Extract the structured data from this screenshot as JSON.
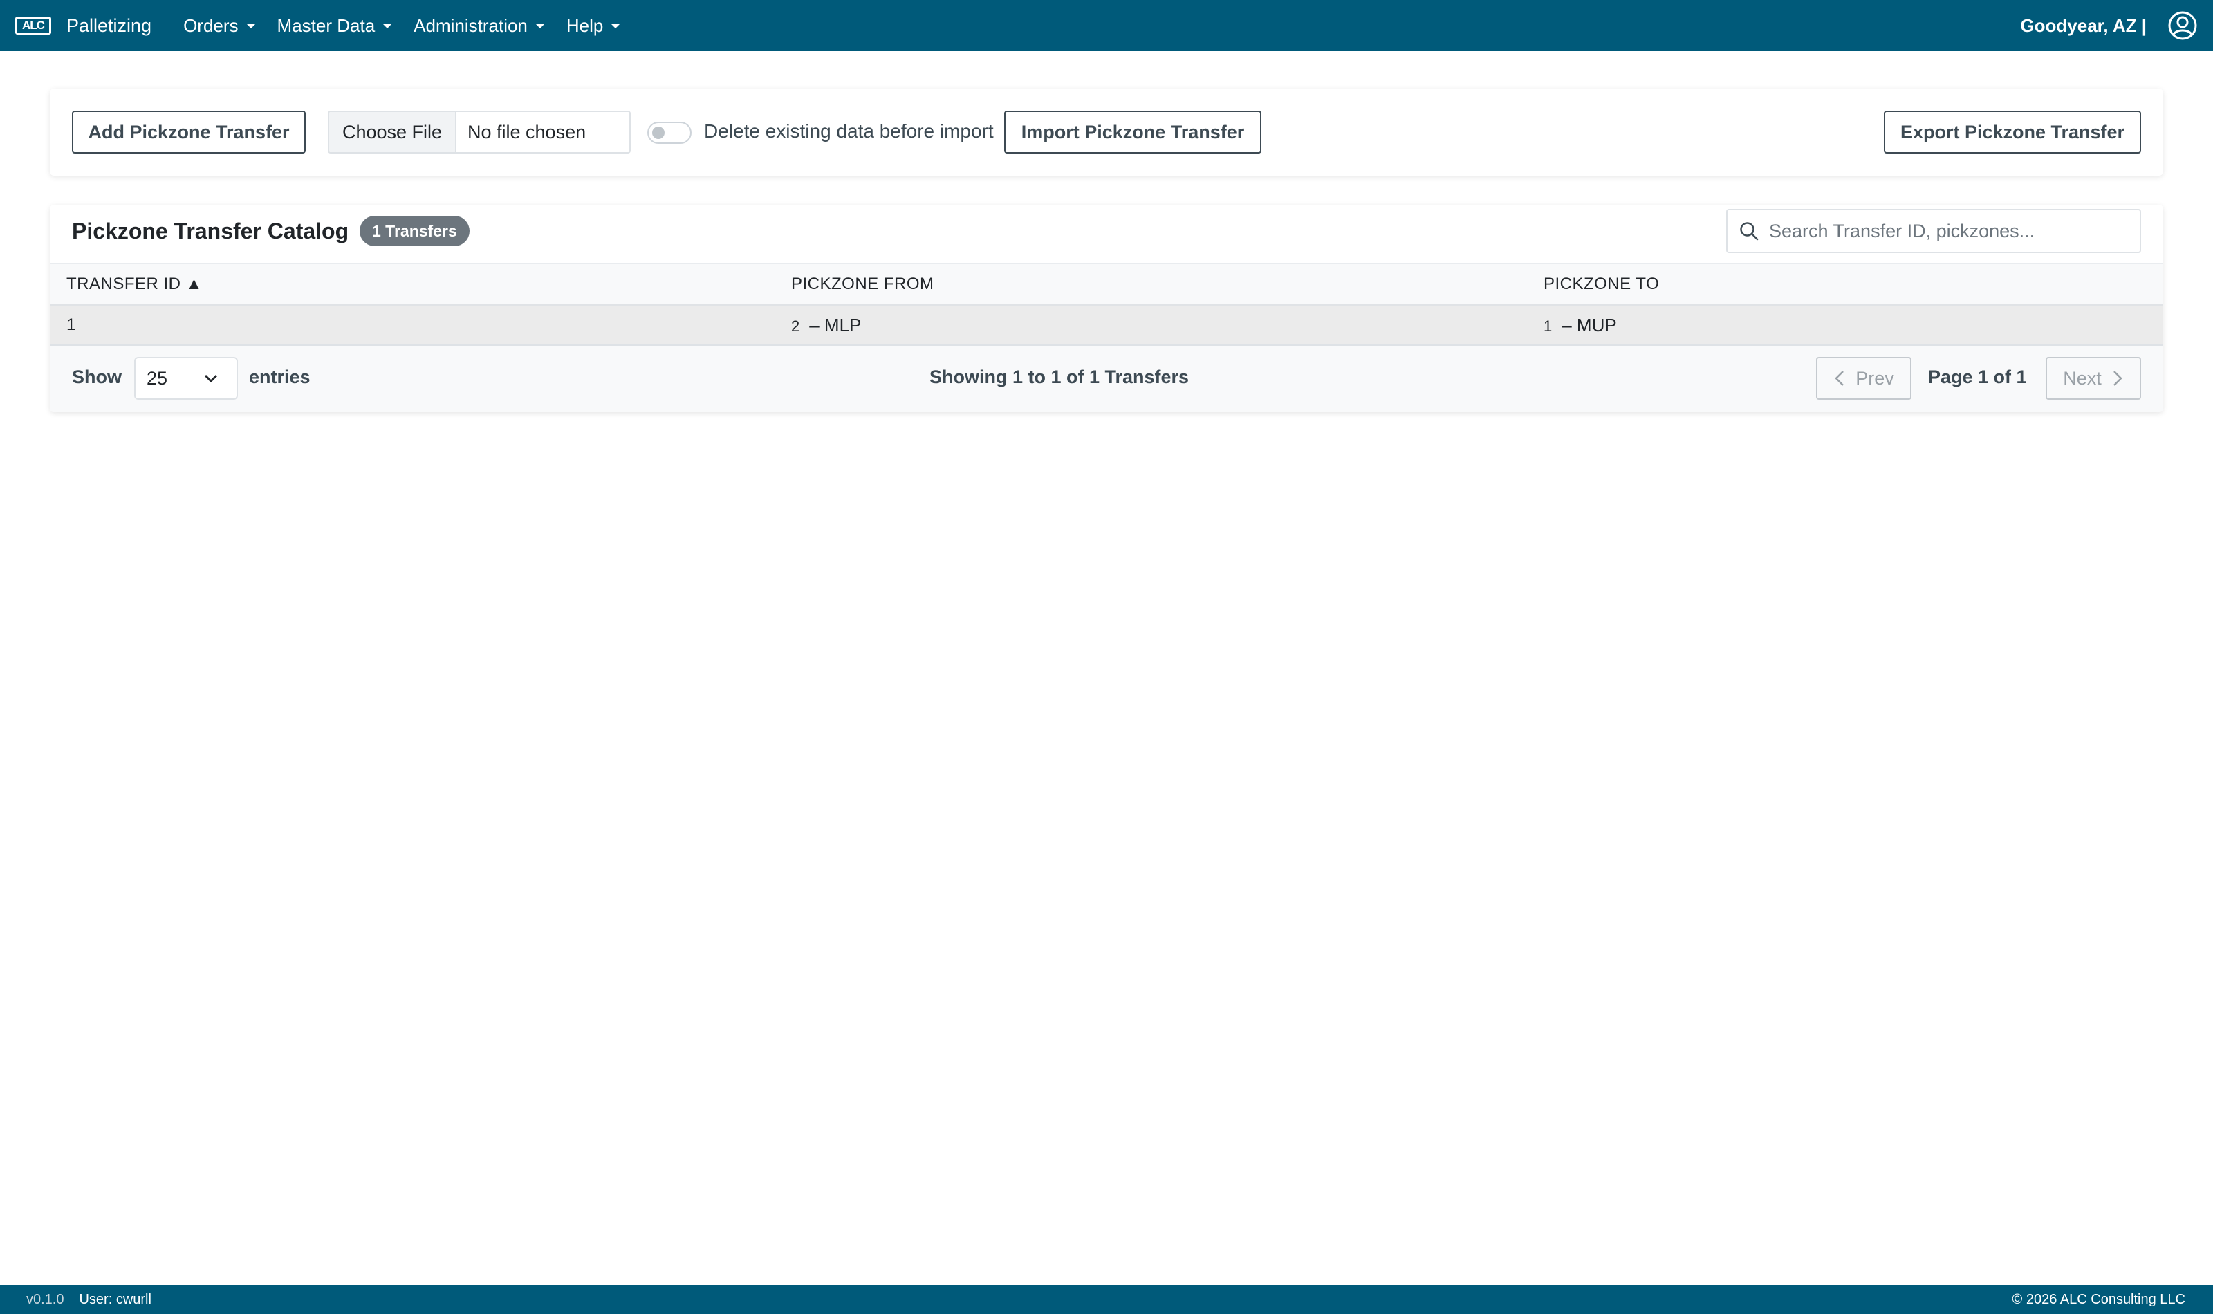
{
  "brand": {
    "logo_text": "ALC",
    "title": "Palletizing"
  },
  "nav": [
    {
      "label": "Orders"
    },
    {
      "label": "Master Data"
    },
    {
      "label": "Administration"
    },
    {
      "label": "Help"
    }
  ],
  "header_right": {
    "location": "Goodyear, AZ |",
    "user_icon": "user-circle-icon"
  },
  "toolbar": {
    "add_label": "Add Pickzone Transfer",
    "file_button": "Choose File",
    "file_status": "No file chosen",
    "delete_toggle_label": "Delete existing data before import",
    "delete_toggle_on": false,
    "import_label": "Import Pickzone Transfer",
    "export_label": "Export Pickzone Transfer"
  },
  "catalog": {
    "title": "Pickzone Transfer Catalog",
    "badge": "1 Transfers",
    "search_placeholder": "Search Transfer ID, pickzones...",
    "search_value": "",
    "columns": [
      "TRANSFER ID ▲",
      "PICKZONE FROM",
      "PICKZONE TO"
    ],
    "rows": [
      {
        "id": "1",
        "from_num": "2",
        "from_name": "– MLP",
        "to_num": "1",
        "to_name": "– MUP"
      }
    ]
  },
  "pagination": {
    "show_label": "Show",
    "page_size": "25",
    "entries_label": "entries",
    "showing": "Showing 1 to 1 of 1 Transfers",
    "prev_label": "Prev",
    "next_label": "Next",
    "page_info": "Page 1 of 1"
  },
  "footer": {
    "version": "v0.1.0",
    "user": "User: cwurll",
    "copyright": "© 2026 ALC Consulting LLC"
  },
  "colors": {
    "brand": "#005a7a",
    "badge": "#6c757d",
    "row_highlight": "#ebebeb"
  }
}
